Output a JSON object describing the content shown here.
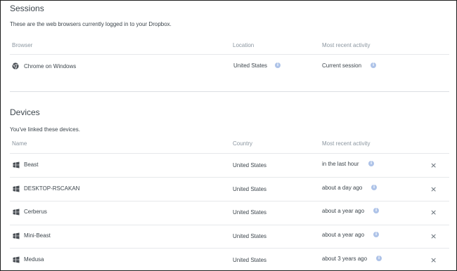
{
  "sessions": {
    "title": "Sessions",
    "description": "These are the web browsers currently logged in to your Dropbox.",
    "headers": {
      "browser": "Browser",
      "location": "Location",
      "activity": "Most recent activity"
    },
    "rows": [
      {
        "browser": "Chrome on Windows",
        "location": "United States",
        "activity": "Current session",
        "icon": "chrome-icon"
      }
    ]
  },
  "devices": {
    "title": "Devices",
    "description": "You've linked these devices.",
    "headers": {
      "name": "Name",
      "country": "Country",
      "activity": "Most recent activity"
    },
    "rows": [
      {
        "name": "Beast",
        "country": "United States",
        "activity": "in the last hour",
        "icon": "windows-icon"
      },
      {
        "name": "DESKTOP-RSCAKAN",
        "country": "United States",
        "activity": "about a day ago",
        "icon": "windows-icon"
      },
      {
        "name": "Cerberus",
        "country": "United States",
        "activity": "about a year ago",
        "icon": "windows-icon"
      },
      {
        "name": "Mini-Beast",
        "country": "United States",
        "activity": "about a year ago",
        "icon": "windows-icon"
      },
      {
        "name": "Medusa",
        "country": "United States",
        "activity": "about 3 years ago",
        "icon": "windows-icon"
      }
    ],
    "unlink_symbol": "×"
  },
  "colors": {
    "text": "#3d464d",
    "muted": "#8b96a0",
    "info": "#aec3e8",
    "rule": "#e6e8eb"
  }
}
